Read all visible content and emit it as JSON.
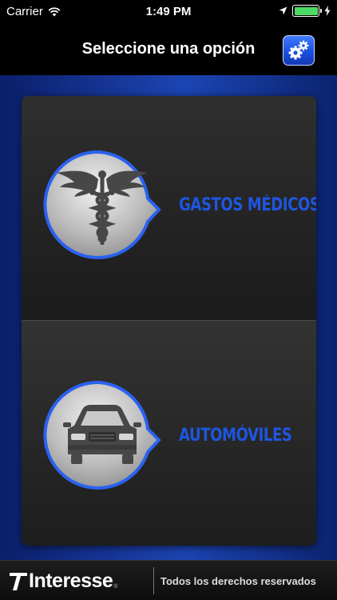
{
  "status_bar": {
    "carrier": "Carrier",
    "time": "1:49 PM",
    "battery_level": 1.0
  },
  "nav": {
    "title": "Seleccione una opción",
    "settings_icon": "gears-icon"
  },
  "options": [
    {
      "label": "GASTOS MÉDICOS",
      "icon": "caduceus-icon"
    },
    {
      "label": "AUTOMÓVILES",
      "icon": "car-icon"
    }
  ],
  "footer": {
    "brand": "Interesse",
    "registered_mark": "®",
    "rights_text": "Todos los derechos reservados"
  },
  "colors": {
    "accent_blue": "#1e56e0",
    "background_blue": "#1a3ea6",
    "battery_green": "#4cd964"
  }
}
